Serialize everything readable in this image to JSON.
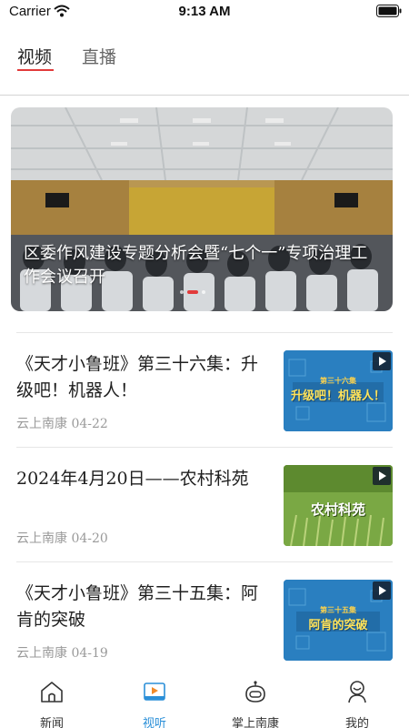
{
  "status_bar": {
    "carrier": "Carrier",
    "time": "9:13 AM"
  },
  "tabs": [
    {
      "label": "视频",
      "active": true
    },
    {
      "label": "直播",
      "active": false
    }
  ],
  "hero": {
    "caption": "区委作风建设专题分析会暨“七个一”专项治理工作会议召开",
    "slide_count": 3,
    "active_slide": 2
  },
  "news": [
    {
      "title": "《天才小鲁班》第三十六集：升级吧！机器人！",
      "source": "云上南康",
      "date": "04-22",
      "thumb_text": "升级吧！机器人！",
      "thumb_sub": "第三十六集",
      "thumb_icon": "play-icon"
    },
    {
      "title": "2024年4月20日——农村科苑",
      "source": "云上南康",
      "date": "04-20",
      "thumb_text": "农村科苑",
      "thumb_sub": "",
      "thumb_icon": "play-icon"
    },
    {
      "title": "《天才小鲁班》第三十五集：阿肯的突破",
      "source": "云上南康",
      "date": "04-19",
      "thumb_text": "阿肯的突破",
      "thumb_sub": "第三十五集",
      "thumb_icon": "play-icon"
    }
  ],
  "tabbar": [
    {
      "label": "新闻",
      "icon": "house-icon",
      "active": false
    },
    {
      "label": "视听",
      "icon": "video-icon",
      "active": true
    },
    {
      "label": "掌上南康",
      "icon": "robot-icon",
      "active": false
    },
    {
      "label": "我的",
      "icon": "user-icon",
      "active": false
    }
  ],
  "colors": {
    "accent_red": "#e23b3b",
    "accent_blue": "#2a8fd8",
    "meta_gray": "#9a9a9a"
  }
}
